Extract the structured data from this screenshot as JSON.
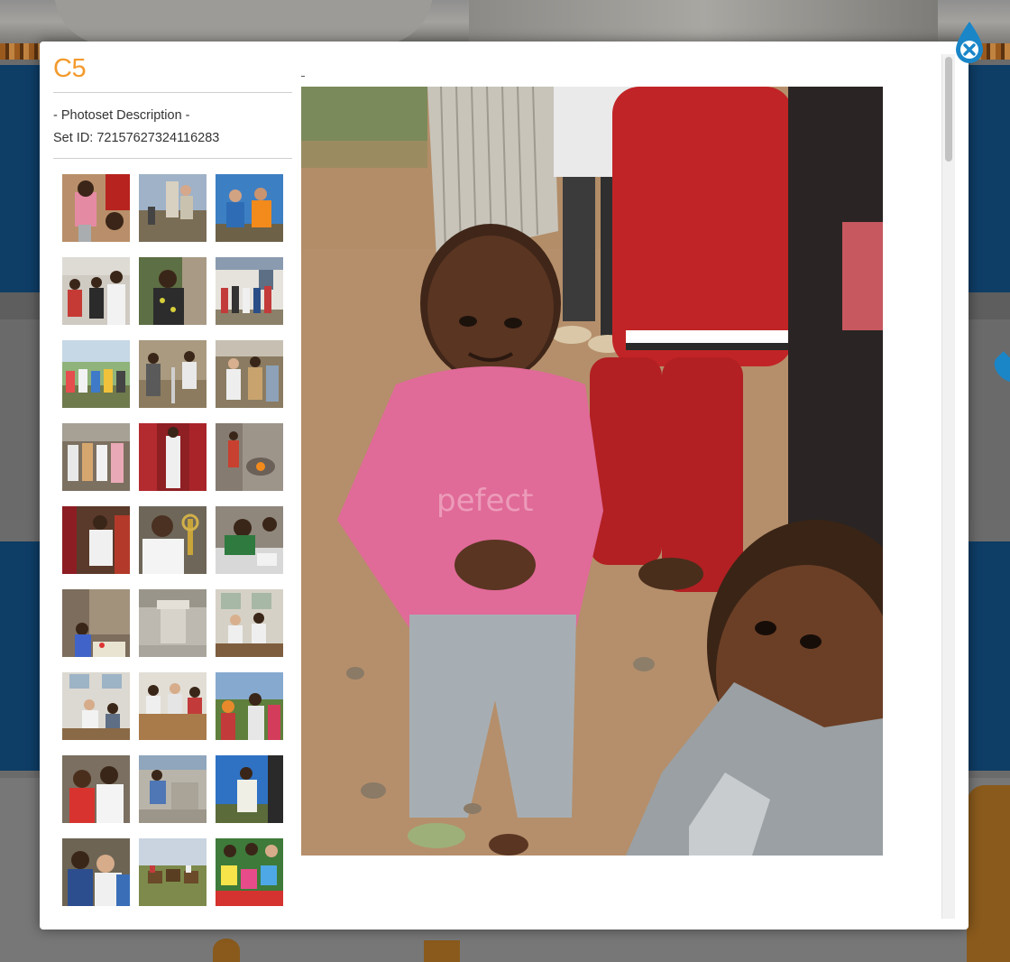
{
  "modal": {
    "title": "C5",
    "description": "- Photoset Description -",
    "set_id": "Set ID: 72157627324116283"
  },
  "thumbnails": [
    {
      "name": "thumb-girl-pink-shirt"
    },
    {
      "name": "thumb-men-well"
    },
    {
      "name": "thumb-two-hikers"
    },
    {
      "name": "thumb-group-men"
    },
    {
      "name": "thumb-woman-smiling"
    },
    {
      "name": "thumb-group-building"
    },
    {
      "name": "thumb-group-outdoor"
    },
    {
      "name": "thumb-men-pump"
    },
    {
      "name": "thumb-people-village"
    },
    {
      "name": "thumb-crowd-street"
    },
    {
      "name": "thumb-red-curtain"
    },
    {
      "name": "thumb-stove-kitchen"
    },
    {
      "name": "thumb-priest-red"
    },
    {
      "name": "thumb-man-cross"
    },
    {
      "name": "thumb-drawing-table"
    },
    {
      "name": "thumb-children-pipes"
    },
    {
      "name": "thumb-concrete-post"
    },
    {
      "name": "thumb-classroom-desks"
    },
    {
      "name": "thumb-classroom-window"
    },
    {
      "name": "thumb-classroom-group"
    },
    {
      "name": "thumb-women-field"
    },
    {
      "name": "thumb-two-women-smiling"
    },
    {
      "name": "thumb-men-concrete"
    },
    {
      "name": "thumb-man-white-wrap"
    },
    {
      "name": "thumb-women-together"
    },
    {
      "name": "thumb-horses-field"
    },
    {
      "name": "thumb-children-cards"
    }
  ],
  "colors": {
    "title_orange": "#f39a2c",
    "close_blue": "#1a86c8"
  },
  "icons": {
    "close": "close-droplet-icon"
  }
}
